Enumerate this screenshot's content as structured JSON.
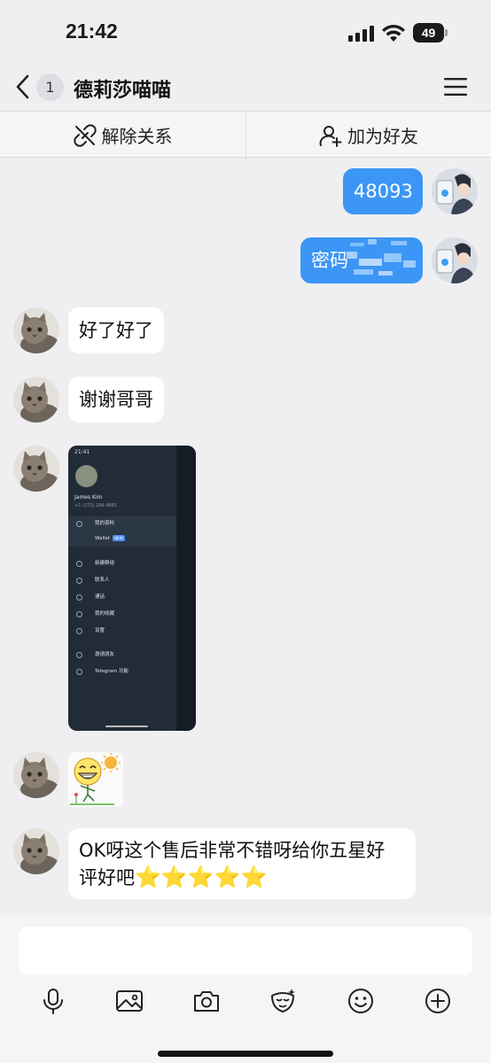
{
  "status_bar": {
    "time": "21:42",
    "battery": "49"
  },
  "nav": {
    "unread_count": "1",
    "title": "德莉莎喵喵"
  },
  "actions": {
    "unbind_label": "解除关系",
    "add_friend_label": "加为好友"
  },
  "messages": [
    {
      "direction": "out",
      "text": "48093"
    },
    {
      "direction": "out",
      "text": "密码"
    },
    {
      "direction": "in",
      "text": "好了好了"
    },
    {
      "direction": "in",
      "text": "谢谢哥哥"
    },
    {
      "direction": "in",
      "type": "image"
    },
    {
      "direction": "in",
      "type": "sticker"
    },
    {
      "direction": "in",
      "text_line1": "OK呀这个售后非常不错呀给你五星好",
      "text_line2": "评好吧",
      "stars": "⭐⭐⭐⭐⭐"
    }
  ],
  "screenshot_image": {
    "time": "21:41",
    "name": "James Kim",
    "phone": "+1 (272) 299-4881",
    "menu": [
      "我的资料",
      "Wallet",
      "新建群组",
      "联系人",
      "通话",
      "我的收藏",
      "设置",
      "邀请朋友",
      "Telegram 功能"
    ],
    "wallet_tag": "NEW"
  },
  "input": {
    "placeholder": ""
  },
  "toolbar": [
    "mic-icon",
    "image-icon",
    "camera-icon",
    "voice-change-icon",
    "emoji-icon",
    "plus-icon"
  ],
  "colors": {
    "outgoing_bubble": "#3c96f5",
    "incoming_bubble": "#ffffff",
    "background": "#efeff1"
  }
}
